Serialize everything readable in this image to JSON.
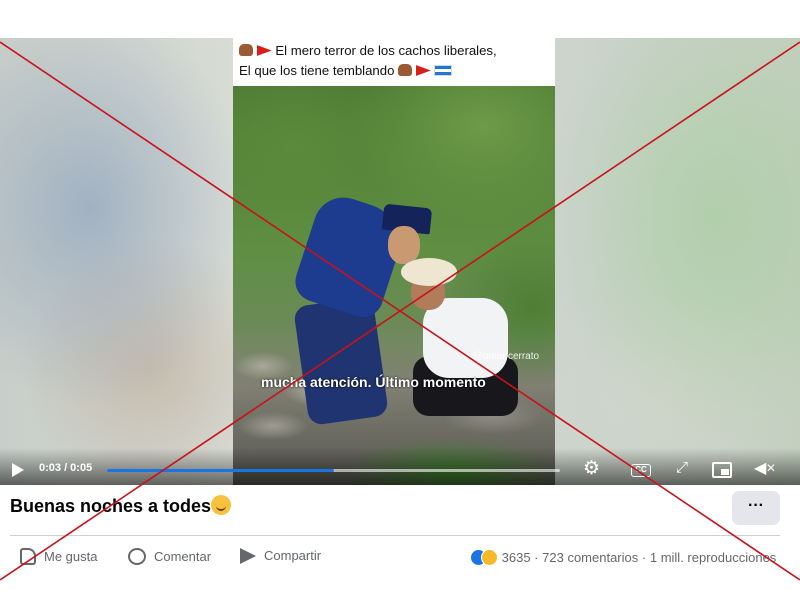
{
  "video": {
    "caption_line1": "El mero terror de los cachos liberales,",
    "caption_line2": "El que los tiene temblando",
    "watermark": "omar.cerrato",
    "subtitle": "mucha atención. Último momento",
    "time": "0:03 / 0:05",
    "progress": 0.5,
    "accent": "#1b74e4",
    "icons": [
      "play-icon",
      "gear-icon",
      "cc-icon",
      "expand-icon",
      "pip-icon",
      "mute-icon"
    ],
    "cc_label": "CC"
  },
  "post": {
    "title": "Buenas noches a todes",
    "more_label": "···"
  },
  "actions": {
    "like": "Me gusta",
    "comment": "Comentar",
    "share": "Compartir"
  },
  "stats": {
    "reactions": "3635",
    "comments": "723 comentarios",
    "views": "1 mill. reproducciones",
    "separator": "·"
  },
  "overlay": {
    "color": "#c8111a"
  }
}
